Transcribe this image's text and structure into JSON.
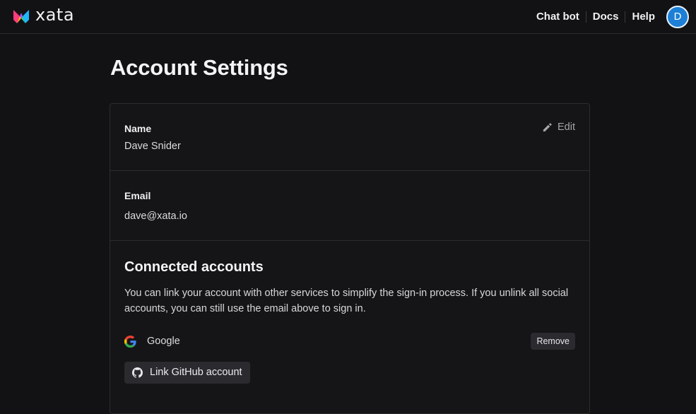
{
  "header": {
    "brand": "xata",
    "nav": [
      {
        "label": "Chat bot"
      },
      {
        "label": "Docs"
      },
      {
        "label": "Help"
      }
    ],
    "avatar_initial": "D"
  },
  "page": {
    "title": "Account Settings"
  },
  "profile": {
    "name_label": "Name",
    "name_value": "Dave Snider",
    "edit_label": "Edit",
    "email_label": "Email",
    "email_value": "dave@xata.io"
  },
  "connected": {
    "title": "Connected accounts",
    "description": "You can link your account with other services to simplify the sign-in process. If you unlink all social accounts, you can still use the email above to sign in.",
    "providers": [
      {
        "name": "Google",
        "icon": "google-icon",
        "action_label": "Remove"
      }
    ],
    "link_github_label": "Link GitHub account"
  },
  "colors": {
    "background": "#121214",
    "avatar": "#1d7fd6",
    "button_bg": "#2b2b2f"
  }
}
